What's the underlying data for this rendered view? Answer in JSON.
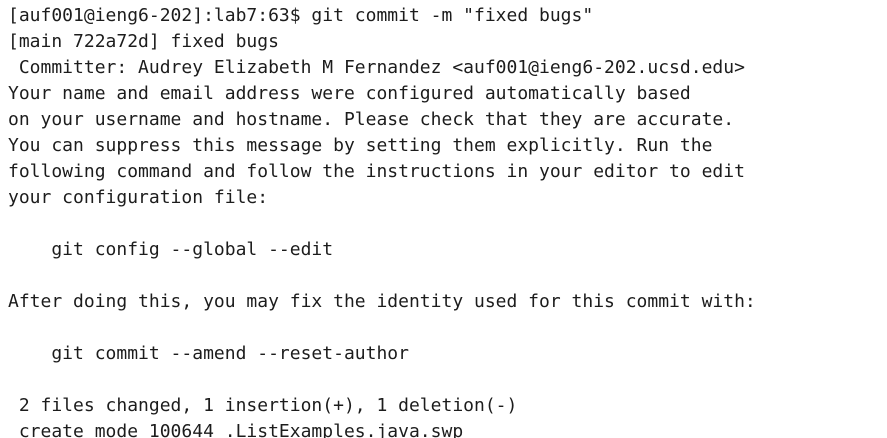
{
  "terminal": {
    "lines": [
      "[auf001@ieng6-202]:lab7:63$ git commit -m \"fixed bugs\"",
      "[main 722a72d] fixed bugs",
      " Committer: Audrey Elizabeth M Fernandez <auf001@ieng6-202.ucsd.edu>",
      "Your name and email address were configured automatically based",
      "on your username and hostname. Please check that they are accurate.",
      "You can suppress this message by setting them explicitly. Run the",
      "following command and follow the instructions in your editor to edit",
      "your configuration file:",
      "",
      "    git config --global --edit",
      "",
      "After doing this, you may fix the identity used for this commit with:",
      "",
      "    git commit --amend --reset-author",
      "",
      " 2 files changed, 1 insertion(+), 1 deletion(-)",
      " create mode 100644 .ListExamples.java.swp"
    ]
  }
}
